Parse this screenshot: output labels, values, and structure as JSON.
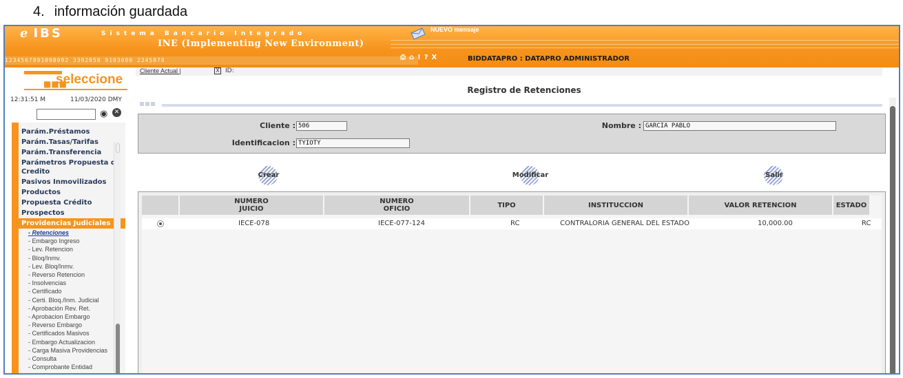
{
  "caption": {
    "number": "4.",
    "text": "información guardada"
  },
  "header": {
    "logo_e": "e",
    "logo_ibs": "IBS",
    "system_name": "Sistema Bancario Integrado",
    "subtitle": "INE (Implementing New Environment)",
    "digits": "1234567891098092    3392058     9103080    2345878",
    "new_message": "NUEVO mensaje",
    "user": "BIDDATAPRO : DATAPRO ADMINISTRADOR"
  },
  "left": {
    "select_label": "seleccione",
    "time": "12:31:51 M",
    "date": "11/03/2020 DMY",
    "menu_groups": [
      "Parám.Préstamos",
      "Parám.Tasas/Tarifas",
      "Parám.Transferencia",
      "Parámetros Propuesta de Credito",
      "Pasivos Inmovilizados",
      "Productos",
      "Propuesta Crédito",
      "Prospectos",
      "Providencias Judiciales"
    ],
    "sub_items": [
      "- Retenciones",
      "- Embargo Ingreso",
      "- Lev. Retencion",
      "- Bloq/Inmv.",
      "- Lev. Bloq/Inmv.",
      "- Reverso Retencion",
      "- Insolvencias",
      "- Certificado",
      "- Certi. Bloq./Inm. Judicial",
      "- Aprobación Rev. Ret.",
      "- Aprobacion Embargo",
      "- Reverso Embargo",
      "- Certificados Masivos",
      "- Embargo Actualizacion",
      "- Carga Masiva Providencias",
      "- Consulta",
      "- Comprobante Entidad"
    ]
  },
  "main": {
    "crumb_client": "Cliente Actual |",
    "crumb_box": "X",
    "crumb_id": "ID:",
    "title": "Registro de Retenciones",
    "form": {
      "cliente_label": "Cliente :",
      "cliente_value": "506",
      "nombre_label": "Nombre :",
      "nombre_value": "GARCIA  PABLO",
      "ident_label": "Identificacion :",
      "ident_value": "TYIOTY"
    },
    "actions": {
      "crear": "Crear",
      "modificar": "Modificar",
      "salir": "Salir"
    },
    "table": {
      "headers": {
        "numero_juicio": "NUMERO\nJUICIO",
        "numero_oficio": "NUMERO\nOFICIO",
        "tipo": "TIPO",
        "institucion": "INSTITUCCION",
        "valor": "VALOR RETENCION",
        "estado": "ESTADO"
      },
      "rows": [
        {
          "juicio": "IECE-078",
          "oficio": "IECE-077-124",
          "tipo": "RC",
          "institucion": "CONTRALORIA GENERAL DEL ESTADO",
          "valor": "10,000.00",
          "estado": "RC"
        }
      ]
    }
  },
  "colors": {
    "accent": "#f7941d",
    "frame": "#4f7fbf"
  }
}
